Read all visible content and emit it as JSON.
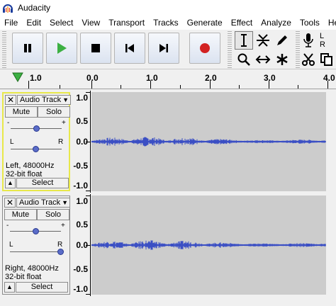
{
  "window": {
    "title": "Audacity"
  },
  "menu": [
    "File",
    "Edit",
    "Select",
    "View",
    "Transport",
    "Tracks",
    "Generate",
    "Effect",
    "Analyze",
    "Tools",
    "Hel"
  ],
  "ruler": {
    "labels": [
      "1.0",
      "0.0",
      "1.0",
      "2.0",
      "3.0",
      "4.0"
    ]
  },
  "tracks": [
    {
      "name": "Audio Track",
      "mute_label": "Mute",
      "solo_label": "Solo",
      "gain_minus": "-",
      "gain_plus": "+",
      "pan_left": "L",
      "pan_right": "R",
      "info_line1": "Left, 48000Hz",
      "info_line2": "32-bit float",
      "select_label": "Select",
      "pan": 0.0,
      "scale": [
        "1.0",
        "0.5",
        "0.0",
        "-0.5",
        "-1.0"
      ]
    },
    {
      "name": "Audio Track",
      "mute_label": "Mute",
      "solo_label": "Solo",
      "gain_minus": "-",
      "gain_plus": "+",
      "pan_left": "L",
      "pan_right": "R",
      "info_line1": "Right, 48000Hz",
      "info_line2": "32-bit float",
      "select_label": "Select",
      "pan": 1.0,
      "scale": [
        "1.0",
        "0.5",
        "0.0",
        "-0.5",
        "-1.0"
      ]
    }
  ],
  "tools": {
    "meter_l": "L",
    "meter_r": "R"
  },
  "colors": {
    "waveform": "#3b4fc4",
    "track_selected": "#e8e84a",
    "record": "#d22222",
    "play": "#3cb043"
  }
}
